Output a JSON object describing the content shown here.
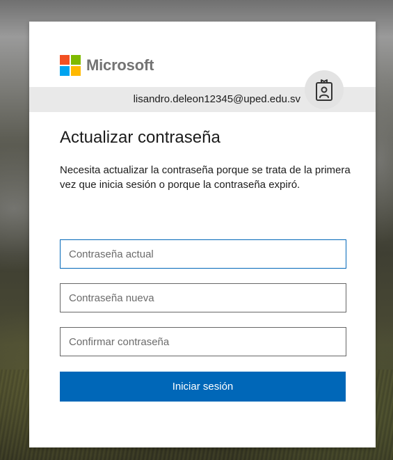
{
  "brand": {
    "name": "Microsoft",
    "logo_colors": [
      "#f25022",
      "#7fba00",
      "#00a4ef",
      "#ffb900"
    ]
  },
  "identity": {
    "email": "lisandro.deleon12345@uped.edu.sv",
    "icon": "badge-icon"
  },
  "form": {
    "title": "Actualizar contraseña",
    "description": "Necesita actualizar la contraseña porque se trata de la primera vez que inicia sesión o porque la contraseña expiró.",
    "current_password_placeholder": "Contraseña actual",
    "new_password_placeholder": "Contraseña nueva",
    "confirm_password_placeholder": "Confirmar contraseña",
    "submit_label": "Iniciar sesión"
  },
  "colors": {
    "accent": "#0067b8",
    "text": "#1b1b1b",
    "brand_text": "#737373"
  }
}
